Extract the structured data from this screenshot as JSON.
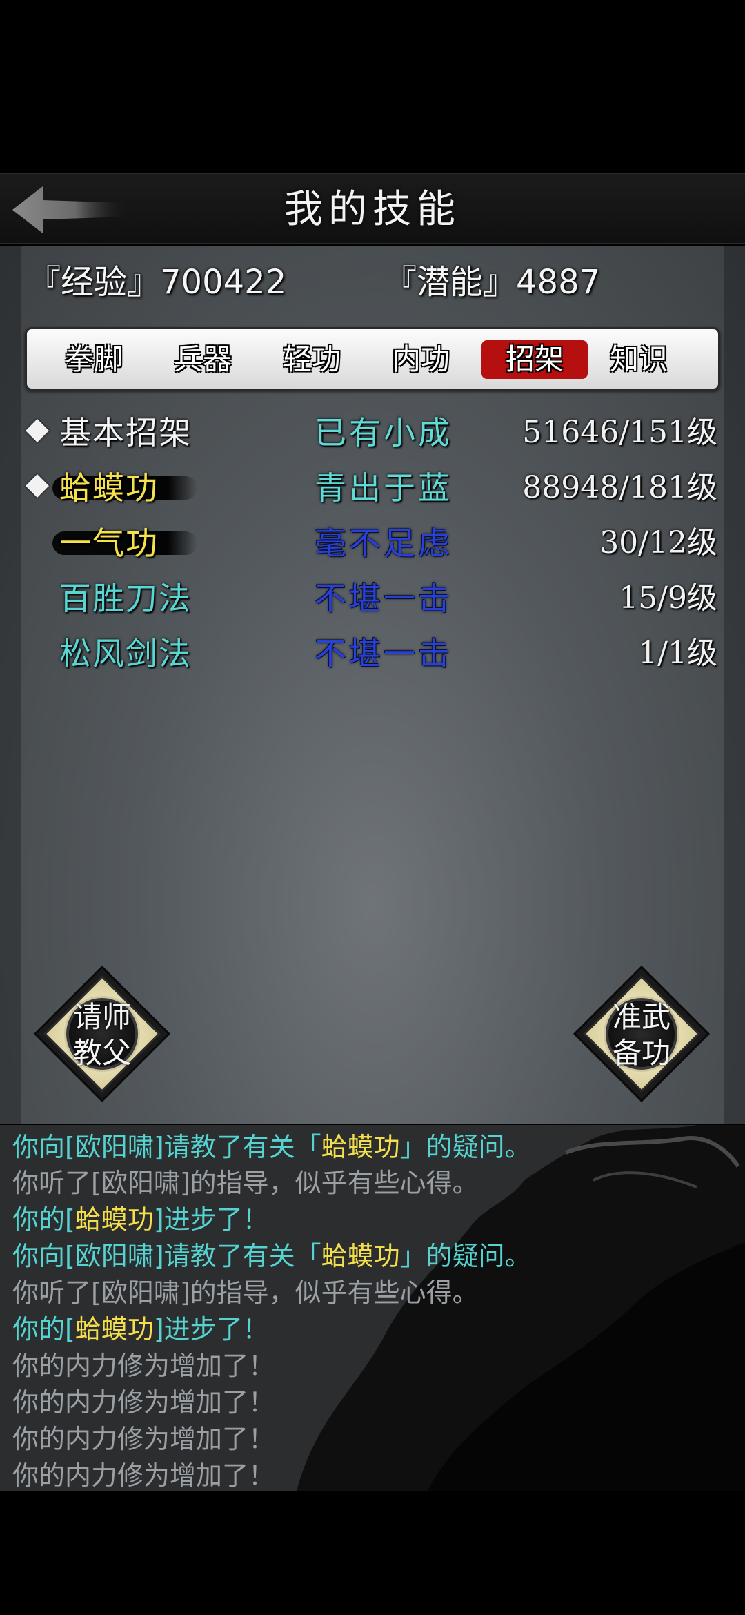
{
  "header": {
    "title": "我的技能"
  },
  "stats": {
    "exp": "『经验』700422",
    "potential": "『潜能』4887"
  },
  "tabs": [
    {
      "label": "拳脚",
      "active": false
    },
    {
      "label": "兵器",
      "active": false
    },
    {
      "label": "轻功",
      "active": false
    },
    {
      "label": "内功",
      "active": false
    },
    {
      "label": "招架",
      "active": true
    },
    {
      "label": "知识",
      "active": false
    }
  ],
  "skills": [
    {
      "name": "基本招架",
      "rank": "已有小成",
      "level": "51646/151级",
      "equipped": true
    },
    {
      "name": "蛤蟆功",
      "rank": "青出于蓝",
      "level": "88948/181级",
      "equipped": true
    },
    {
      "name": "一气功",
      "rank": "毫不足虑",
      "level": "30/12级",
      "equipped": false
    },
    {
      "name": "百胜刀法",
      "rank": "不堪一击",
      "level": "15/9级",
      "equipped": false
    },
    {
      "name": "松风剑法",
      "rank": "不堪一击",
      "level": "1/1级",
      "equipped": false
    }
  ],
  "buttons": {
    "teacher": {
      "line1": "请师",
      "line2": "教父"
    },
    "prepare": {
      "line1": "准武",
      "line2": "备功"
    }
  },
  "log": [
    {
      "pre": "你向[欧阳啸]请教了有关「",
      "hl": "蛤蟆功",
      "post": "」的疑问。"
    },
    {
      "text": "你听了[欧阳啸]的指导，似乎有些心得。"
    },
    {
      "pre": "你的[",
      "hl": "蛤蟆功",
      "post": "]进步了！"
    },
    {
      "pre": "你向[欧阳啸]请教了有关「",
      "hl": "蛤蟆功",
      "post": "」的疑问。"
    },
    {
      "text": "你听了[欧阳啸]的指导，似乎有些心得。"
    },
    {
      "pre": "你的[",
      "hl": "蛤蟆功",
      "post": "]进步了！"
    },
    {
      "text": "你的内力修为增加了！"
    },
    {
      "text": "你的内力修为增加了！"
    },
    {
      "text": "你的内力修为增加了！"
    },
    {
      "text": "你的内力修为增加了！"
    }
  ],
  "colors": {
    "tab_active": "#b50f10",
    "log_cyan": "#55d3d1",
    "log_gray": "#9aa0a4",
    "highlight": "#f3de4b"
  }
}
